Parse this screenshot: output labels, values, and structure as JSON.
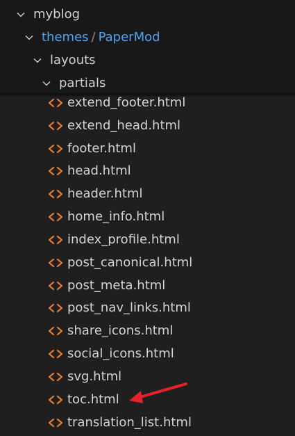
{
  "explorer": {
    "root": {
      "label": "myblog"
    },
    "compact_folder": {
      "part1": "themes",
      "separator": "/",
      "part2": "PaperMod"
    },
    "layouts": {
      "label": "layouts"
    },
    "partials": {
      "label": "partials"
    },
    "files": [
      "extend_footer.html",
      "extend_head.html",
      "footer.html",
      "head.html",
      "header.html",
      "home_info.html",
      "index_profile.html",
      "post_canonical.html",
      "post_meta.html",
      "post_nav_links.html",
      "share_icons.html",
      "social_icons.html",
      "svg.html",
      "toc.html",
      "translation_list.html"
    ]
  },
  "icons": {
    "folder_expanded": "chevron-down-icon",
    "html_file": "html-code-icon",
    "annotation": "red-arrow-icon"
  },
  "colors": {
    "html_icon": "#e37933",
    "compact_folder_text": "#4ea6f2",
    "annotation_arrow": "#e8202a",
    "background": "#1f1f1f"
  }
}
